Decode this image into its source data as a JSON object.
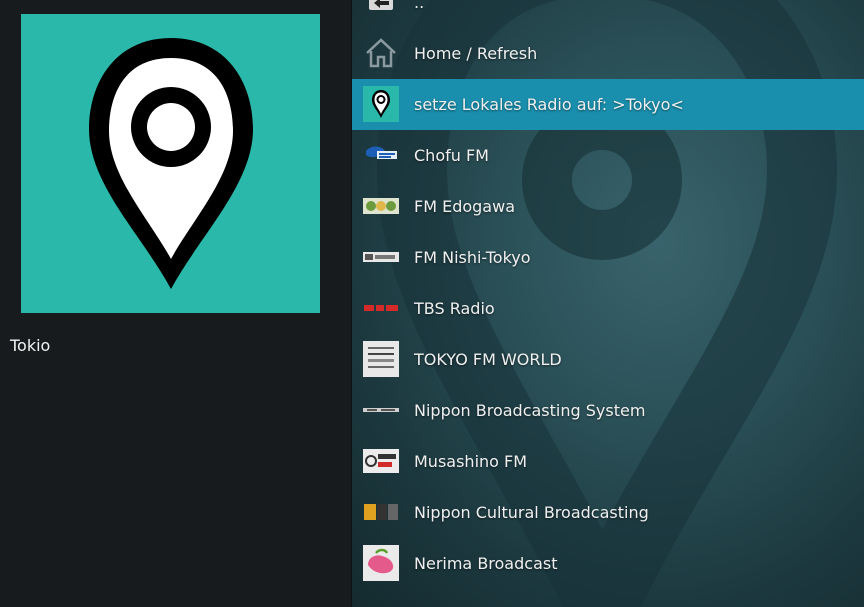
{
  "sidebar": {
    "label": "Tokio"
  },
  "list": {
    "items": [
      {
        "label": "..",
        "icon": "back-arrow-icon"
      },
      {
        "label": "Home / Refresh",
        "icon": "home-icon"
      },
      {
        "label": "setze Lokales Radio auf: >Tokyo<",
        "icon": "location-pin-icon",
        "selected": true
      },
      {
        "label": "Chofu FM",
        "icon": "chofu-fm-logo"
      },
      {
        "label": "FM Edogawa",
        "icon": "fm-edogawa-logo"
      },
      {
        "label": "FM Nishi-Tokyo",
        "icon": "fm-nishi-tokyo-logo"
      },
      {
        "label": "TBS Radio",
        "icon": "tbs-radio-logo"
      },
      {
        "label": "TOKYO FM WORLD",
        "icon": "tokyo-fm-world-logo"
      },
      {
        "label": "Nippon Broadcasting System",
        "icon": "nippon-broadcasting-logo"
      },
      {
        "label": "Musashino FM",
        "icon": "musashino-fm-logo"
      },
      {
        "label": "Nippon Cultural Broadcasting",
        "icon": "nippon-cultural-logo"
      },
      {
        "label": "Nerima Broadcast",
        "icon": "nerima-broadcast-logo"
      }
    ]
  },
  "colors": {
    "selected_row": "#1a8fad",
    "thumbnail_bg": "#29b8a9",
    "left_panel_bg": "#171b1d"
  }
}
